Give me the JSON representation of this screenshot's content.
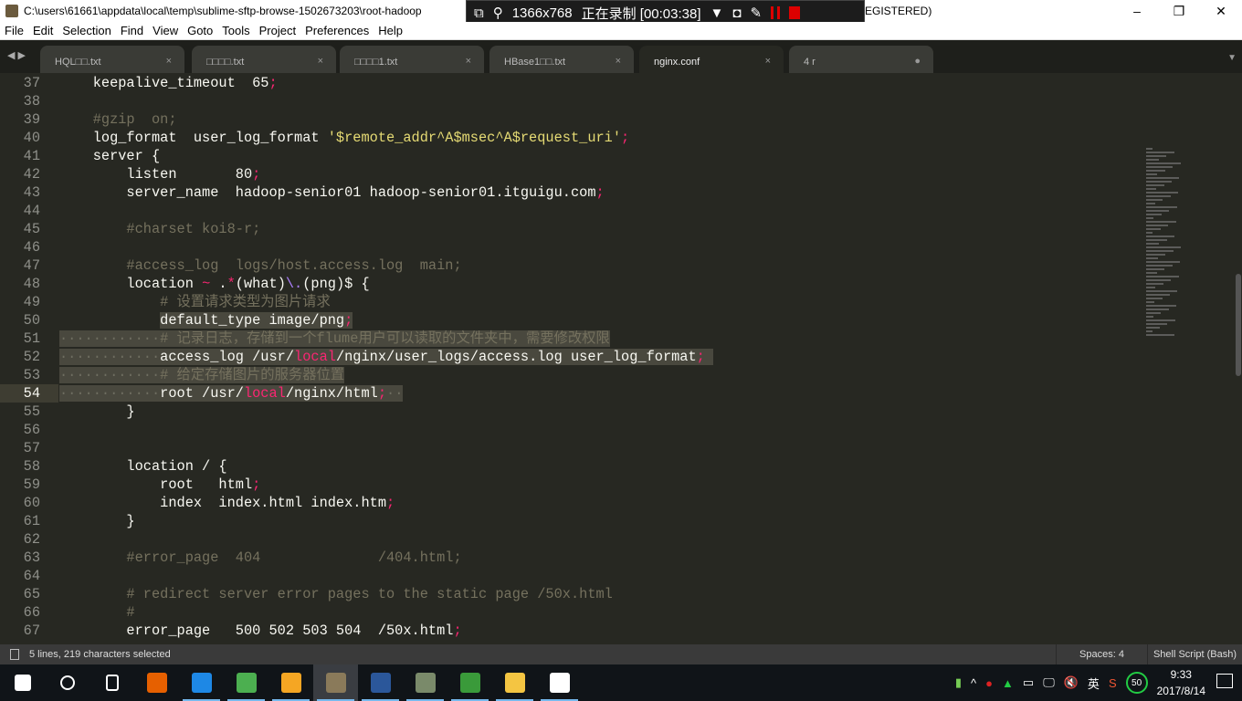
{
  "window": {
    "title": "C:\\users\\61661\\appdata\\local\\temp\\sublime-sftp-browse-1502673203\\root-hadoop",
    "title_suffix": "EGISTERED)",
    "minimize": "–",
    "maximize": "❐",
    "close": "✕"
  },
  "recorder": {
    "resolution": "1366x768",
    "status": "正在录制 [00:03:38]"
  },
  "menu": [
    "File",
    "Edit",
    "Selection",
    "Find",
    "View",
    "Goto",
    "Tools",
    "Project",
    "Preferences",
    "Help"
  ],
  "tabs": [
    {
      "label": "HQL□□.txt",
      "close": "×",
      "active": false
    },
    {
      "label": "□□□□.txt",
      "close": "×",
      "active": false
    },
    {
      "label": "□□□□1.txt",
      "close": "×",
      "active": false
    },
    {
      "label": "HBase1□□.txt",
      "close": "×",
      "active": false
    },
    {
      "label": "nginx.conf",
      "close": "×",
      "active": true
    },
    {
      "label": "4 r",
      "close": "●",
      "active": false
    }
  ],
  "editor": {
    "current_line": 54,
    "lines": [
      {
        "n": "37",
        "t": [
          [
            "    keepalive_timeout  65",
            "pl"
          ],
          [
            ";",
            "pu"
          ]
        ]
      },
      {
        "n": "38",
        "t": []
      },
      {
        "n": "39",
        "t": [
          [
            "    #gzip  on;",
            "cm"
          ]
        ]
      },
      {
        "n": "40",
        "t": [
          [
            "    log_format  user_log_format ",
            "pl"
          ],
          [
            "'$remote_addr^A$msec^A$request_uri'",
            "st"
          ],
          [
            ";",
            "pu"
          ]
        ]
      },
      {
        "n": "41",
        "t": [
          [
            "    server {",
            "pl"
          ]
        ]
      },
      {
        "n": "42",
        "t": [
          [
            "        listen       80",
            "pl"
          ],
          [
            ";",
            "pu"
          ]
        ]
      },
      {
        "n": "43",
        "t": [
          [
            "        server_name  hadoop-senior01 hadoop-senior01.itguigu.com",
            "pl"
          ],
          [
            ";",
            "pu"
          ]
        ]
      },
      {
        "n": "44",
        "t": []
      },
      {
        "n": "45",
        "t": [
          [
            "        #charset koi8-r;",
            "cm"
          ]
        ]
      },
      {
        "n": "46",
        "t": []
      },
      {
        "n": "47",
        "t": [
          [
            "        #access_log  logs/host.access.log  main;",
            "cm"
          ]
        ]
      },
      {
        "n": "48",
        "t": [
          [
            "        location ",
            "pl"
          ],
          [
            "~",
            "pu"
          ],
          [
            " .",
            "pl"
          ],
          [
            "*",
            "pu"
          ],
          [
            "(what)",
            "pl"
          ],
          [
            "\\.",
            "ae"
          ],
          [
            "(png)$ {",
            "pl"
          ]
        ]
      },
      {
        "n": "49",
        "t": [
          [
            "            # 设置请求类型为图片请求",
            "cm"
          ]
        ]
      },
      {
        "n": "50",
        "t": [
          [
            "            ",
            "pl"
          ],
          [
            "default_type image/png",
            "pl sel"
          ],
          [
            ";",
            "pu sel"
          ]
        ]
      },
      {
        "n": "51",
        "t": [
          [
            "············",
            "ws-sel"
          ],
          [
            "# 记录日志，存储到一个flume用户可以读取的文件夹中，需要修改权限",
            "cm sel"
          ]
        ]
      },
      {
        "n": "52",
        "t": [
          [
            "············",
            "ws-sel"
          ],
          [
            "access_log /usr/",
            "pl sel"
          ],
          [
            "local",
            "pu sel"
          ],
          [
            "/nginx/user_logs/access.log user_log_format",
            "pl sel"
          ],
          [
            ";",
            "pu sel"
          ],
          [
            " ",
            "sel"
          ]
        ]
      },
      {
        "n": "53",
        "t": [
          [
            "············",
            "ws-sel"
          ],
          [
            "# 给定存储图片的服务器位置",
            "cm sel"
          ]
        ]
      },
      {
        "n": "54",
        "t": [
          [
            "············",
            "ws-sel"
          ],
          [
            "root /usr/",
            "pl sel"
          ],
          [
            "local",
            "pu sel"
          ],
          [
            "/nginx/html",
            "pl sel"
          ],
          [
            ";",
            "pu sel"
          ],
          [
            "··",
            "ws-sel"
          ]
        ]
      },
      {
        "n": "55",
        "t": [
          [
            "        }",
            "pl"
          ]
        ]
      },
      {
        "n": "56",
        "t": []
      },
      {
        "n": "57",
        "t": []
      },
      {
        "n": "58",
        "t": [
          [
            "        location / {",
            "pl"
          ]
        ]
      },
      {
        "n": "59",
        "t": [
          [
            "            root   html",
            "pl"
          ],
          [
            ";",
            "pu"
          ]
        ]
      },
      {
        "n": "60",
        "t": [
          [
            "            index  index.html index.htm",
            "pl"
          ],
          [
            ";",
            "pu"
          ]
        ]
      },
      {
        "n": "61",
        "t": [
          [
            "        }",
            "pl"
          ]
        ]
      },
      {
        "n": "62",
        "t": []
      },
      {
        "n": "63",
        "t": [
          [
            "        #error_page  404              /404.html;",
            "cm"
          ]
        ]
      },
      {
        "n": "64",
        "t": []
      },
      {
        "n": "65",
        "t": [
          [
            "        # redirect server error pages to the static page /50x.html",
            "cm"
          ]
        ]
      },
      {
        "n": "66",
        "t": [
          [
            "        #",
            "cm"
          ]
        ]
      },
      {
        "n": "67",
        "t": [
          [
            "        error_page   500 502 503 504  /50x.html",
            "pl"
          ],
          [
            ";",
            "pu"
          ]
        ]
      }
    ]
  },
  "status": {
    "selection": "5 lines, 219 characters selected",
    "indent": "Spaces: 4",
    "syntax": "Shell Script (Bash)"
  },
  "taskbar": {
    "apps": [
      "start",
      "cortana",
      "task-view",
      "firefox",
      "app-m",
      "browser-e",
      "app-q",
      "sublime-text",
      "word",
      "app-img",
      "vc",
      "file-explorer",
      "photos"
    ],
    "tray_ime": "英",
    "tray_badge": "50",
    "time": "9:33",
    "date": "2017/8/14"
  }
}
